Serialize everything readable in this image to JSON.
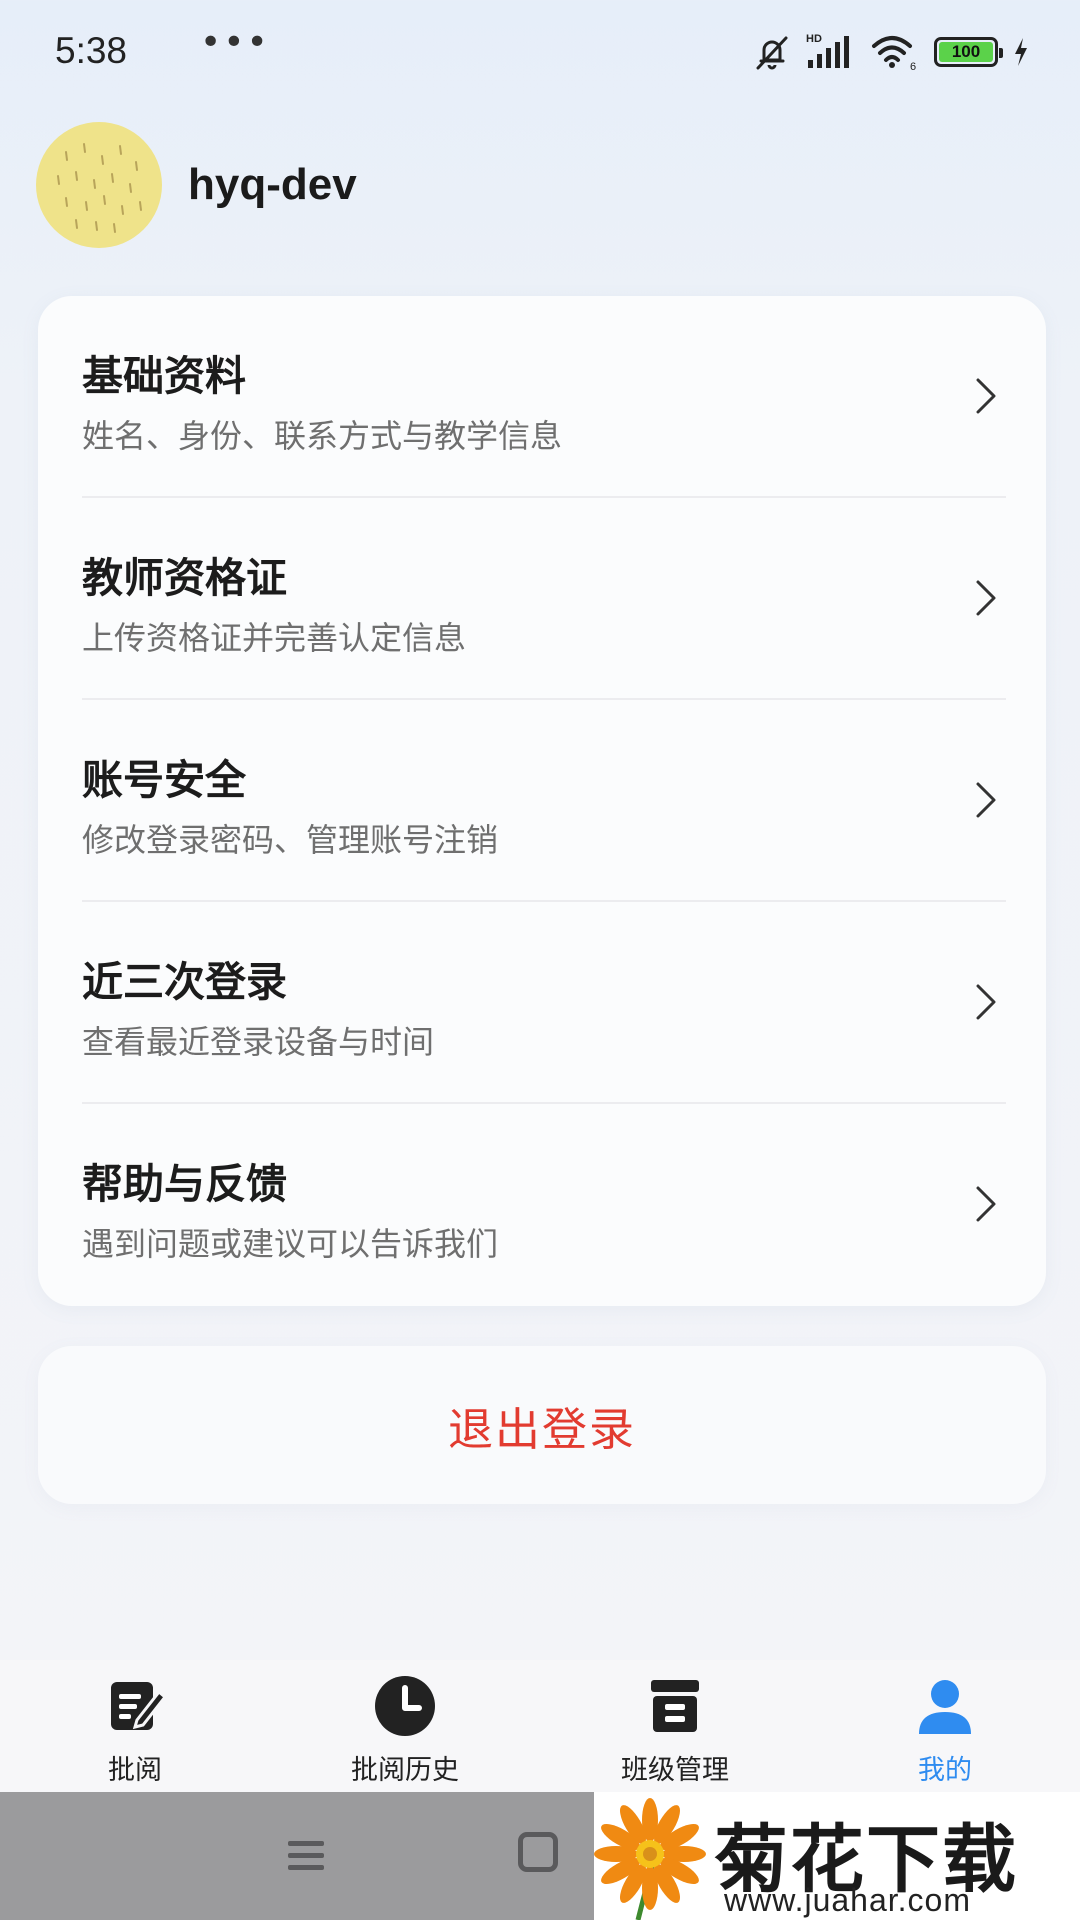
{
  "status_bar": {
    "time": "5:38",
    "dots": "•••",
    "network_label": "HD",
    "wifi_label": "6",
    "battery": "100"
  },
  "profile": {
    "username": "hyq-dev"
  },
  "menu": [
    {
      "title": "基础资料",
      "subtitle": "姓名、身份、联系方式与教学信息"
    },
    {
      "title": "教师资格证",
      "subtitle": "上传资格证并完善认定信息"
    },
    {
      "title": "账号安全",
      "subtitle": "修改登录密码、管理账号注销"
    },
    {
      "title": "近三次登录",
      "subtitle": "查看最近登录设备与时间"
    },
    {
      "title": "帮助与反馈",
      "subtitle": "遇到问题或建议可以告诉我们"
    }
  ],
  "logout": {
    "label": "退出登录",
    "color": "#e23b30"
  },
  "tabs": [
    {
      "label": "批阅",
      "icon": "edit-note-icon",
      "active": false
    },
    {
      "label": "批阅历史",
      "icon": "clock-icon",
      "active": false
    },
    {
      "label": "班级管理",
      "icon": "archive-box-icon",
      "active": false
    },
    {
      "label": "我的",
      "icon": "user-icon",
      "active": true
    }
  ],
  "accent_color": "#2f8cf0",
  "watermark": {
    "title": "菊花下载网",
    "url": "www.juahar.com"
  }
}
